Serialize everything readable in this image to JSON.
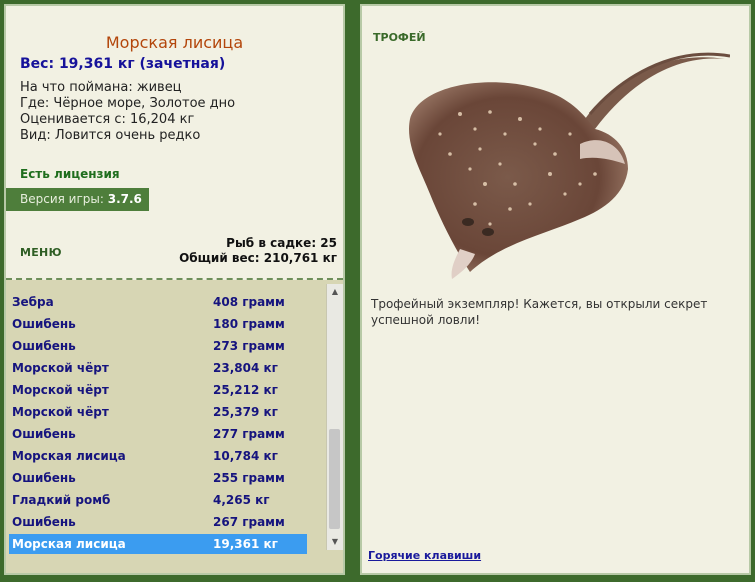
{
  "catch": {
    "fish_name": "Морская лисица",
    "weight_line": "Вес: 19,361 кг (зачетная)",
    "bait_line": "На что поймана: живец",
    "location_line": "Где: Чёрное море, Золотое дно",
    "value_line": "Оценивается с: 16,204 кг",
    "rarity_line": "Вид: Ловится очень редко"
  },
  "license": "Есть лицензия",
  "version": {
    "label": "Версия игры:",
    "value": "3.7.6"
  },
  "menu_label": "МЕНЮ",
  "stats": {
    "count_line": "Рыб в садке: 25",
    "total_line": "Общий вес: 210,761 кг"
  },
  "fish_list": [
    {
      "name": "Зебра",
      "weight": "408 грамм"
    },
    {
      "name": "Ошибень",
      "weight": "180 грамм"
    },
    {
      "name": "Ошибень",
      "weight": "273 грамм"
    },
    {
      "name": "Морской чёрт",
      "weight": "23,804 кг"
    },
    {
      "name": "Морской чёрт",
      "weight": "25,212 кг"
    },
    {
      "name": "Морской чёрт",
      "weight": "25,379 кг"
    },
    {
      "name": "Ошибень",
      "weight": "277 грамм"
    },
    {
      "name": "Морская лисица",
      "weight": "10,784 кг"
    },
    {
      "name": "Ошибень",
      "weight": "255 грамм"
    },
    {
      "name": "Гладкий ромб",
      "weight": "4,265 кг"
    },
    {
      "name": "Ошибень",
      "weight": "267 грамм"
    },
    {
      "name": "Морская лисица",
      "weight": "19,361 кг"
    }
  ],
  "selected_index": 11,
  "trophy": {
    "label": "ТРОФЕЙ",
    "text": "Трофейный экземпляр! Кажется, вы открыли секрет успешной ловли!"
  },
  "hotkeys_link": "Горячие клавиши",
  "colors": {
    "background": "#3d6a2c",
    "panel": "#f2f1e3",
    "list_bg": "#d7d6b4",
    "selection": "#3b9cf0",
    "title": "#b3460b",
    "fish_text": "#16147e"
  }
}
